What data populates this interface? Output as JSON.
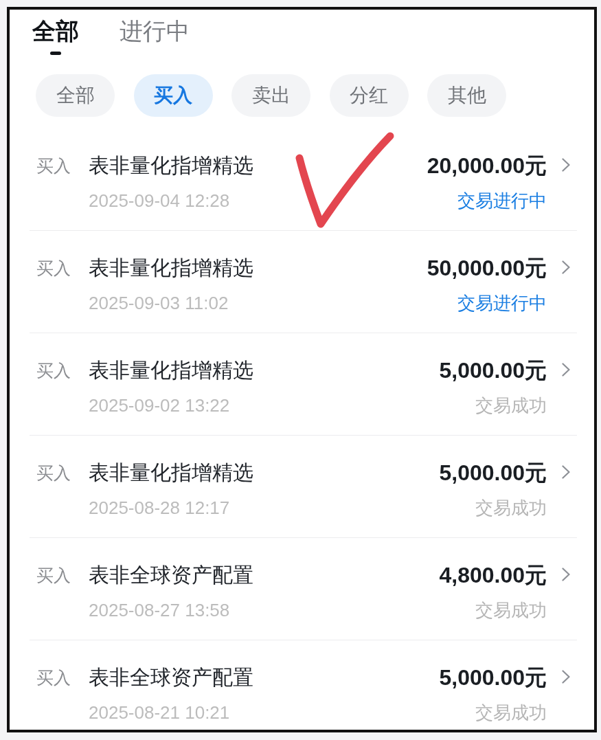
{
  "tabs": [
    {
      "label": "全部",
      "selected": true
    },
    {
      "label": "进行中",
      "selected": false
    }
  ],
  "filters": [
    {
      "label": "全部",
      "selected": false
    },
    {
      "label": "买入",
      "selected": true
    },
    {
      "label": "卖出",
      "selected": false
    },
    {
      "label": "分红",
      "selected": false
    },
    {
      "label": "其他",
      "selected": false
    }
  ],
  "transactions": [
    {
      "type": "买入",
      "name": "表非量化指增精选",
      "time": "2025-09-04 12:28",
      "amount": "20,000.00元",
      "status": "交易进行中",
      "in_progress": true
    },
    {
      "type": "买入",
      "name": "表非量化指增精选",
      "time": "2025-09-03 11:02",
      "amount": "50,000.00元",
      "status": "交易进行中",
      "in_progress": true
    },
    {
      "type": "买入",
      "name": "表非量化指增精选",
      "time": "2025-09-02 13:22",
      "amount": "5,000.00元",
      "status": "交易成功",
      "in_progress": false
    },
    {
      "type": "买入",
      "name": "表非量化指增精选",
      "time": "2025-08-28 12:17",
      "amount": "5,000.00元",
      "status": "交易成功",
      "in_progress": false
    },
    {
      "type": "买入",
      "name": "表非全球资产配置",
      "time": "2025-08-27 13:58",
      "amount": "4,800.00元",
      "status": "交易成功",
      "in_progress": false
    },
    {
      "type": "买入",
      "name": "表非全球资产配置",
      "time": "2025-08-21 10:21",
      "amount": "5,000.00元",
      "status": "交易成功",
      "in_progress": false
    }
  ],
  "annotations": [
    {
      "kind": "check"
    }
  ]
}
